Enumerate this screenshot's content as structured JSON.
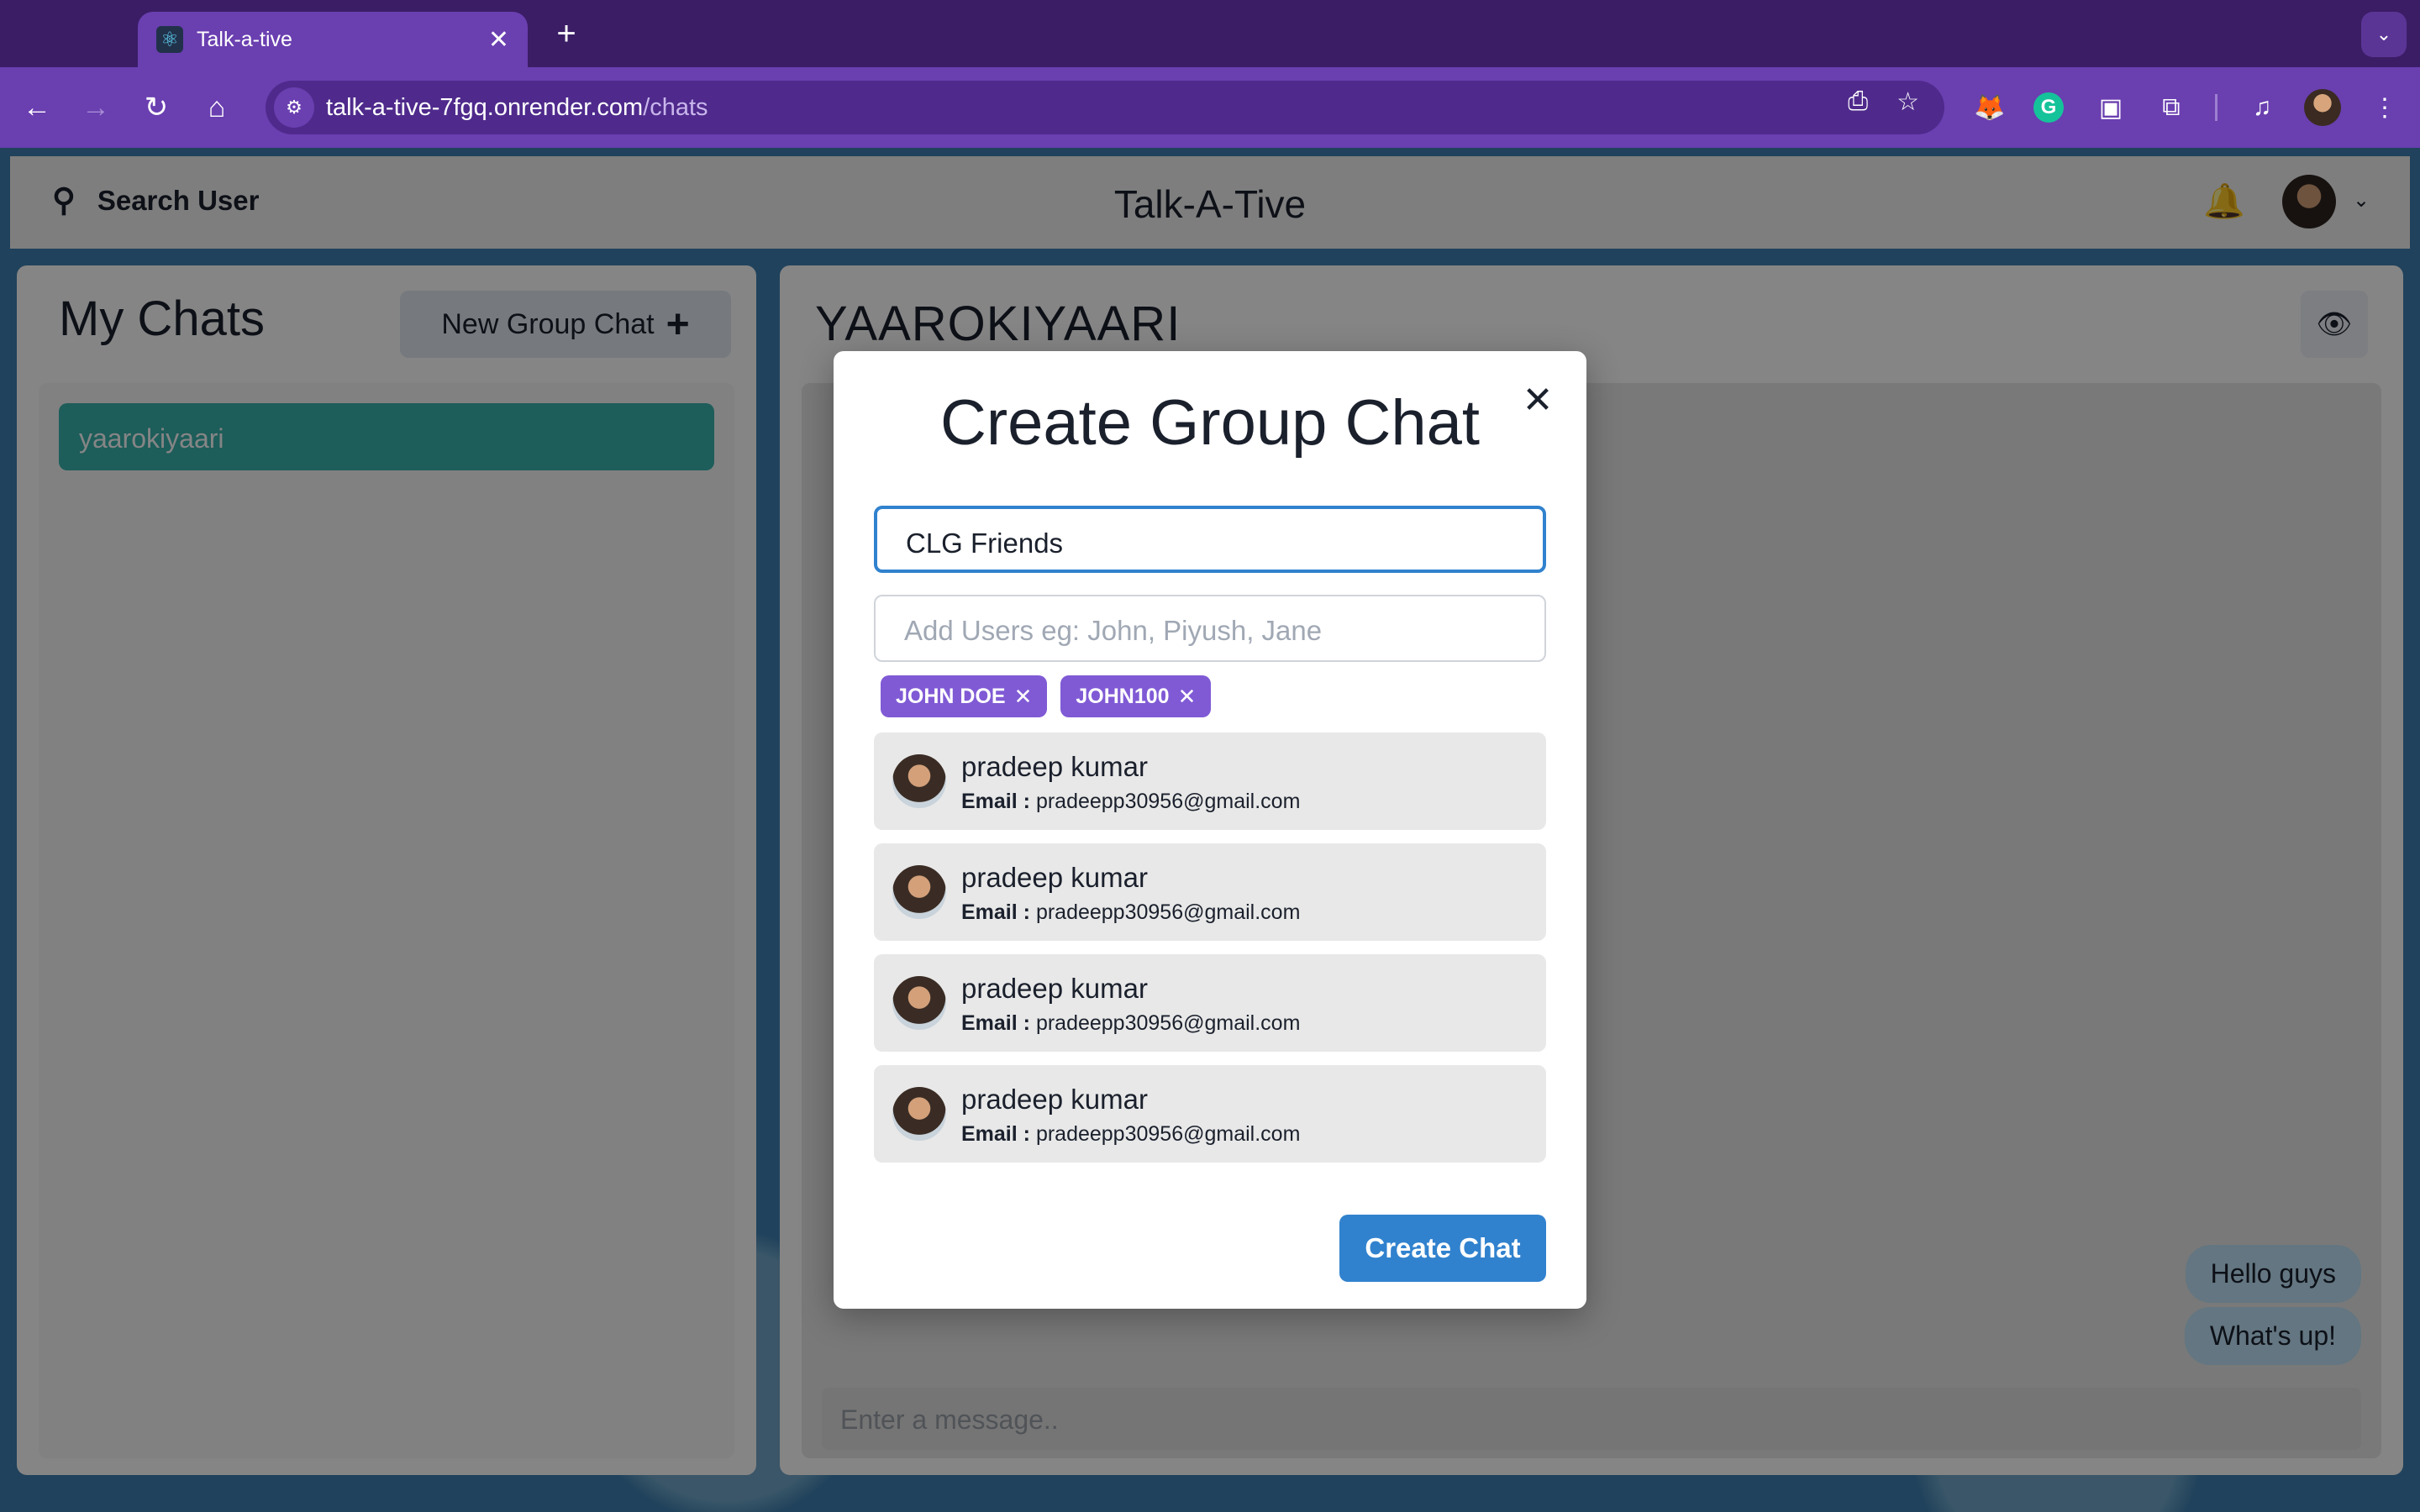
{
  "browser": {
    "tab_title": "Talk-a-tive",
    "tab_close": "✕",
    "new_tab": "+",
    "url_host": "talk-a-tive-7fgq.onrender.com",
    "url_path": "/chats"
  },
  "header": {
    "search_label": "Search User",
    "brand": "Talk-A-Tive"
  },
  "sidebar": {
    "title": "My Chats",
    "new_group_label": "New Group Chat",
    "chats": [
      {
        "name": "yaarokiyaari"
      }
    ]
  },
  "chat": {
    "title": "YAAROKIYAARI",
    "messages": [
      "Hello guys",
      "What's up!"
    ],
    "input_placeholder": "Enter a message.."
  },
  "modal": {
    "title": "Create Group Chat",
    "chat_name_value": "CLG Friends",
    "add_users_placeholder": "Add Users eg: John, Piyush, Jane",
    "selected_users": [
      "JOHN DOE",
      "JOHN100"
    ],
    "search_results": [
      {
        "name": "pradeep kumar",
        "email_label": "Email :",
        "email": "pradeepp30956@gmail.com"
      },
      {
        "name": "pradeep kumar",
        "email_label": "Email :",
        "email": "pradeepp30956@gmail.com"
      },
      {
        "name": "pradeep kumar",
        "email_label": "Email :",
        "email": "pradeepp30956@gmail.com"
      },
      {
        "name": "pradeep kumar",
        "email_label": "Email :",
        "email": "pradeepp30956@gmail.com"
      }
    ],
    "submit_label": "Create Chat"
  },
  "colors": {
    "chrome": "#6a3fb0",
    "active_chat": "#38b2ac",
    "chip": "#805ad5",
    "primary": "#3182ce"
  }
}
